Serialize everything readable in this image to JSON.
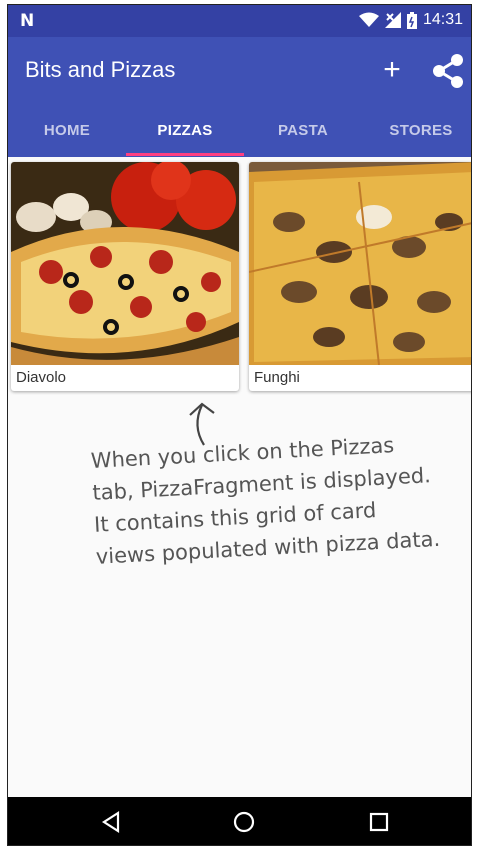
{
  "status": {
    "carrier_logo": "N",
    "time": "14:31",
    "icons": [
      "wifi-icon",
      "signal-icon",
      "battery-icon"
    ]
  },
  "toolbar": {
    "title": "Bits and Pizzas",
    "add_icon": "+",
    "share_icon": "share-icon"
  },
  "tabs": [
    {
      "label": "HOME",
      "active": false
    },
    {
      "label": "PIZZAS",
      "active": true
    },
    {
      "label": "PASTA",
      "active": false
    },
    {
      "label": "STORES",
      "active": false
    }
  ],
  "cards": [
    {
      "name": "Diavolo"
    },
    {
      "name": "Funghi"
    }
  ],
  "annotation": {
    "lines": [
      "When you click on the Pizzas",
      "tab, PizzaFragment is displayed.",
      "It contains this grid of card",
      "views populated with pizza data."
    ]
  },
  "colors": {
    "primary": "#3f51b5",
    "primary_dark": "#3441a4",
    "accent": "#ff4081"
  }
}
